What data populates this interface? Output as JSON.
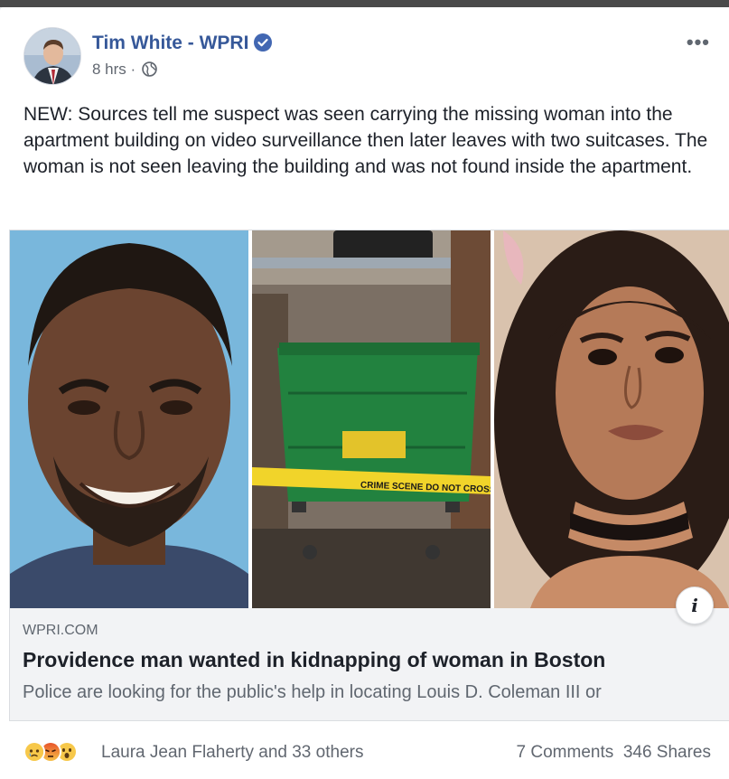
{
  "post": {
    "author": "Tim White - WPRI",
    "time": "8 hrs",
    "separator": "·",
    "more_label": "•••",
    "text": "NEW: Sources tell me suspect was seen carrying the missing woman into the apartment building on video surveillance then later leaves with two suitcases. The woman is not seen leaving the building and was not found inside the apartment."
  },
  "link_preview": {
    "domain": "WPRI.COM",
    "headline": "Providence man wanted in kidnapping of woman in Boston",
    "description": "Police are looking for the public's help in locating Louis D. Coleman III or",
    "info_label": "i",
    "tape_text": "CRIME SCENE DO NOT CROSS"
  },
  "footer": {
    "reaction_names": "Laura Jean Flaherty and 33 others",
    "comments": "7 Comments",
    "shares": "346 Shares",
    "reactions": [
      "sad",
      "angry",
      "wow"
    ]
  },
  "colors": {
    "author_blue": "#365899",
    "verified_blue": "#4267b2",
    "meta_gray": "#616770",
    "page_bg": "#e9ebee"
  },
  "icons": [
    "verified-badge-icon",
    "globe-icon",
    "more-options-icon",
    "info-icon",
    "sad-reaction-icon",
    "angry-reaction-icon",
    "wow-reaction-icon"
  ]
}
